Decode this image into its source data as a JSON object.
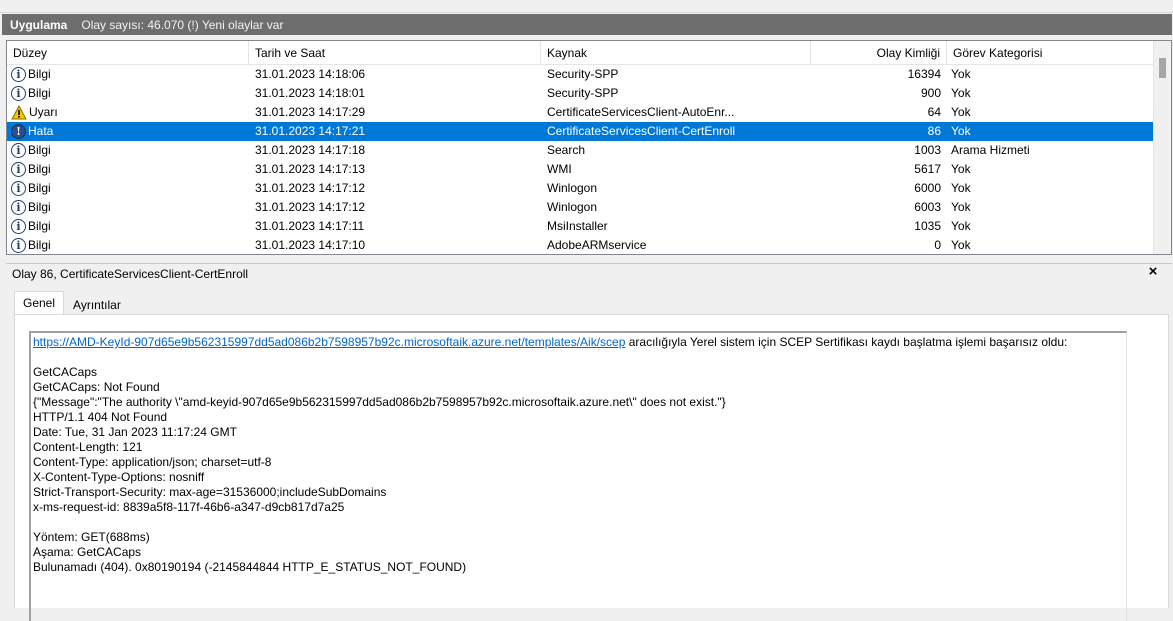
{
  "title_bar": {
    "app": "Uygulama",
    "count": "Olay sayısı: 46.070 (!) Yeni olaylar var"
  },
  "columns": {
    "level": "Düzey",
    "date": "Tarih ve Saat",
    "source": "Kaynak",
    "id": "Olay Kimliği",
    "category": "Görev Kategorisi"
  },
  "rows": [
    {
      "type": "info",
      "level": "Bilgi",
      "date": "31.01.2023 14:18:06",
      "source": "Security-SPP",
      "id": "16394",
      "category": "Yok"
    },
    {
      "type": "info",
      "level": "Bilgi",
      "date": "31.01.2023 14:18:01",
      "source": "Security-SPP",
      "id": "900",
      "category": "Yok"
    },
    {
      "type": "warning",
      "level": "Uyarı",
      "date": "31.01.2023 14:17:29",
      "source": "CertificateServicesClient-AutoEnr...",
      "id": "64",
      "category": "Yok"
    },
    {
      "type": "error",
      "level": "Hata",
      "date": "31.01.2023 14:17:21",
      "source": "CertificateServicesClient-CertEnroll",
      "id": "86",
      "category": "Yok",
      "selected": true
    },
    {
      "type": "info",
      "level": "Bilgi",
      "date": "31.01.2023 14:17:18",
      "source": "Search",
      "id": "1003",
      "category": "Arama Hizmeti"
    },
    {
      "type": "info",
      "level": "Bilgi",
      "date": "31.01.2023 14:17:13",
      "source": "WMI",
      "id": "5617",
      "category": "Yok"
    },
    {
      "type": "info",
      "level": "Bilgi",
      "date": "31.01.2023 14:17:12",
      "source": "Winlogon",
      "id": "6000",
      "category": "Yok"
    },
    {
      "type": "info",
      "level": "Bilgi",
      "date": "31.01.2023 14:17:12",
      "source": "Winlogon",
      "id": "6003",
      "category": "Yok"
    },
    {
      "type": "info",
      "level": "Bilgi",
      "date": "31.01.2023 14:17:11",
      "source": "MsiInstaller",
      "id": "1035",
      "category": "Yok"
    },
    {
      "type": "info",
      "level": "Bilgi",
      "date": "31.01.2023 14:17:10",
      "source": "AdobeARMservice",
      "id": "0",
      "category": "Yok"
    }
  ],
  "icons": {
    "info": "info-icon",
    "warning": "warning-icon",
    "error": "error-icon"
  },
  "detail": {
    "header": "Olay 86, CertificateServicesClient-CertEnroll",
    "close": "×",
    "tabs": [
      "Genel",
      "Ayrıntılar"
    ],
    "link": "https://AMD-KeyId-907d65e9b562315997dd5ad086b2b7598957b92c.microsoftaik.azure.net/templates/Aik/scep",
    "first_line_rest": " aracılığıyla Yerel sistem için SCEP Sertifikası kaydı başlatma işlemi başarısız oldu:",
    "lines": [
      "",
      "GetCACaps",
      "GetCACaps: Not Found",
      "{\"Message\":\"The authority \\\"amd-keyid-907d65e9b562315997dd5ad086b2b7598957b92c.microsoftaik.azure.net\\\" does not exist.\"}",
      "HTTP/1.1 404 Not Found",
      "Date: Tue, 31 Jan 2023 11:17:24 GMT",
      "Content-Length: 121",
      "Content-Type: application/json; charset=utf-8",
      "X-Content-Type-Options: nosniff",
      "Strict-Transport-Security: max-age=31536000;includeSubDomains",
      "x-ms-request-id: 8839a5f8-117f-46b6-a347-d9cb817d7a25",
      "",
      "Yöntem: GET(688ms)",
      "Aşama: GetCACaps",
      "Bulunamadı (404). 0x80190194 (-2145844844 HTTP_E_STATUS_NOT_FOUND)"
    ]
  },
  "colors": {
    "selected": "#0078d7",
    "title_bar": "#6e6e6e",
    "link": "#0066cc"
  }
}
